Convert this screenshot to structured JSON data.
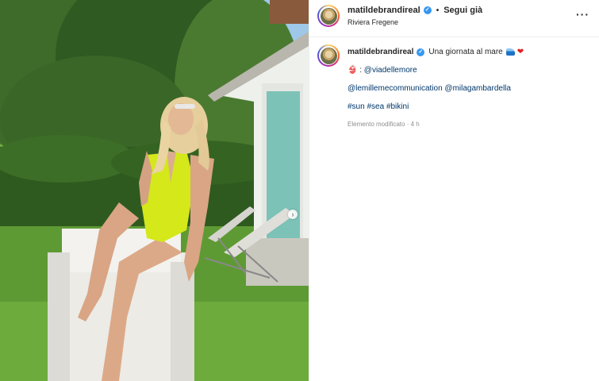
{
  "post": {
    "username": "matildebrandireal",
    "verified": true,
    "follow_label": "Segui già",
    "separator": "•",
    "location": "Riviera Fregene",
    "more_label": "···"
  },
  "caption": {
    "username": "matildebrandireal",
    "text": "Una giornata al mare",
    "emojis": [
      "wave-icon",
      "red-heart-icon"
    ],
    "credit_line": {
      "emoji": "bikini-icon",
      "prefix": ":",
      "mention": "@viadellemore"
    },
    "mentions": [
      "@lemillemecommunication",
      "@milagambardella"
    ],
    "hashtags": [
      "#sun",
      "#sea",
      "#bikini"
    ],
    "edited_label": "Elemento modificato",
    "time_label": "4 h"
  },
  "colors": {
    "verified": "#3897f0",
    "link": "#00376b",
    "swimsuit": "#d4e81a",
    "muted": "#8e8e8e"
  }
}
